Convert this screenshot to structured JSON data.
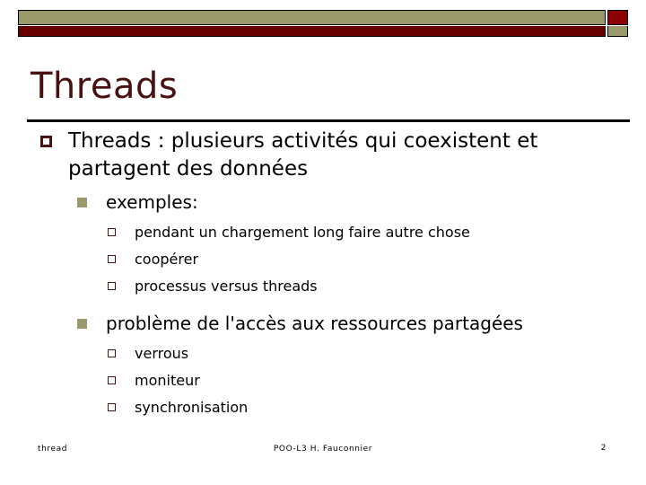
{
  "theme": {
    "accent_khaki": "#99996b",
    "accent_maroon": "#660000",
    "title_color": "#4a1111",
    "text_color": "#000000",
    "background": "#ffffff"
  },
  "header": {
    "deco_top_bar": "khaki-bar",
    "deco_bottom_bar": "maroon-bar",
    "deco_square_top_right": "maroon-square",
    "deco_square_bottom_right": "khaki-square"
  },
  "title": "Threads",
  "content": {
    "level1": {
      "bullet": "hollow-square-bullet",
      "text": "Threads : plusieurs activités qui coexistent et partagent des données"
    },
    "groups": [
      {
        "heading_bullet": "filled-square-bullet",
        "heading": "exemples:",
        "items": [
          "pendant un chargement long faire autre chose",
          "coopérer",
          "processus versus threads"
        ]
      },
      {
        "heading_bullet": "filled-square-bullet",
        "heading": "problème de l'accès aux ressources partagées",
        "items": [
          "verrous",
          "moniteur",
          "synchronisation"
        ]
      }
    ]
  },
  "footer": {
    "left": "thread",
    "center": "POO-L3 H. Fauconnier",
    "page_number": "2"
  }
}
